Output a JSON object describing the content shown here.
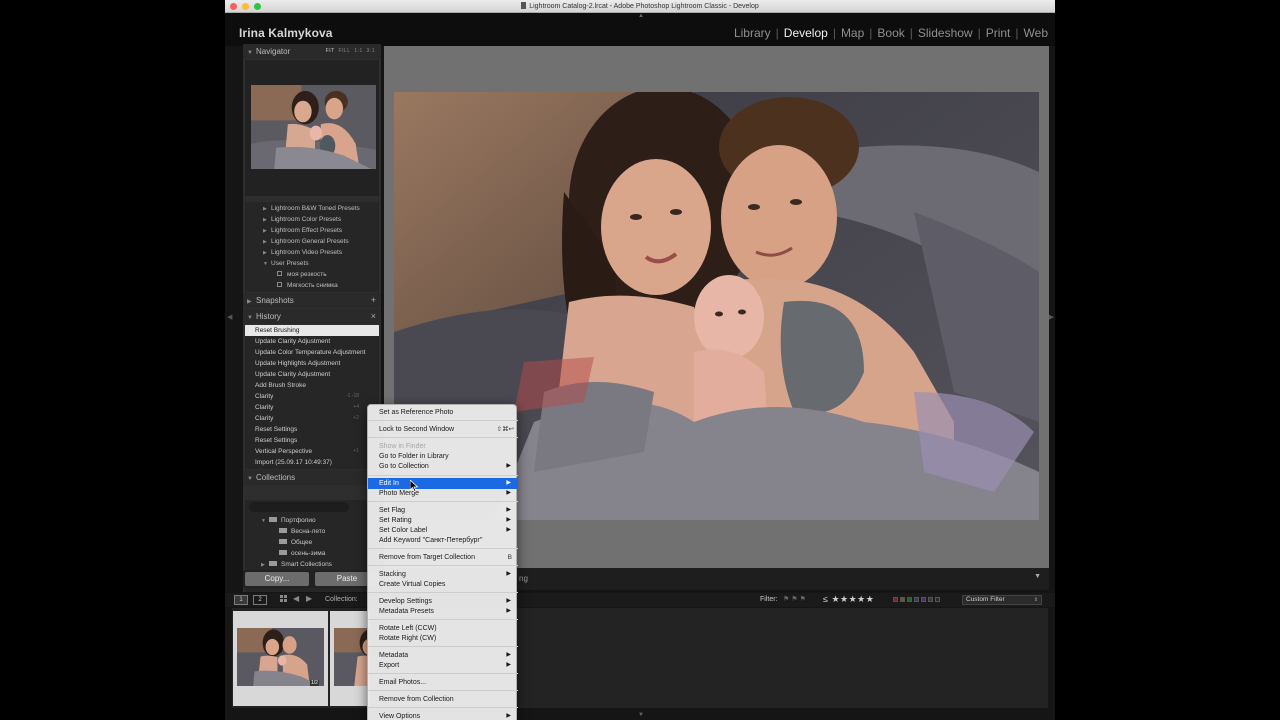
{
  "window": {
    "title": "Lightroom Catalog-2.lrcat - Adobe Photoshop Lightroom Classic - Develop"
  },
  "identity_plate": "Irina Kalmykova",
  "modules": [
    "Library",
    "Develop",
    "Map",
    "Book",
    "Slideshow",
    "Print",
    "Web"
  ],
  "navigator": {
    "title": "Navigator",
    "zoom_fit": "FIT",
    "zoom_fill": "FILL",
    "zoom_1": "1:1",
    "zoom_3": "3:1"
  },
  "presets": [
    "Lightroom B&W Toned Presets",
    "Lightroom Color Presets",
    "Lightroom Effect Presets",
    "Lightroom General Presets",
    "Lightroom Video Presets",
    "User Presets",
    "моя резкость",
    "Мягкость снимка"
  ],
  "snapshots": {
    "title": "Snapshots",
    "add": "+"
  },
  "history": {
    "title": "History",
    "close": "×",
    "items": [
      {
        "label": "Reset Brushing",
        "value": ""
      },
      {
        "label": "Update Clarity Adjustment",
        "value": ""
      },
      {
        "label": "Update Color Temperature Adjustment",
        "value": ""
      },
      {
        "label": "Update Highlights Adjustment",
        "value": ""
      },
      {
        "label": "Update Clarity Adjustment",
        "value": ""
      },
      {
        "label": "Add Brush Stroke",
        "value": ""
      },
      {
        "label": "Clarity",
        "value": "-1   -18"
      },
      {
        "label": "Clarity",
        "value": "+4"
      },
      {
        "label": "Clarity",
        "value": "+2"
      },
      {
        "label": "Reset Settings",
        "value": ""
      },
      {
        "label": "Reset Settings",
        "value": ""
      },
      {
        "label": "Vertical Perspective",
        "value": "+1"
      },
      {
        "label": "Import (25.09.17 10:49:37)",
        "value": ""
      }
    ]
  },
  "collections": {
    "title": "Collections",
    "add": "+",
    "items": [
      {
        "label": "Портфолио"
      },
      {
        "label": "Весна-лето"
      },
      {
        "label": "Общее"
      },
      {
        "label": "осень-зима"
      },
      {
        "label": "Smart Collections"
      },
      {
        "label": "1 +"
      }
    ]
  },
  "buttons": {
    "copy": "Copy...",
    "paste": "Paste"
  },
  "toolbar": {
    "text": "ng"
  },
  "filmstrip": {
    "view1": "1",
    "view2": "2",
    "source": "Collection: ",
    "filter_label": "Filter:",
    "stars_prefix": "≤",
    "stars": "★★★★★",
    "custom_filter": "Custom Filter",
    "badge": "1/2"
  },
  "context_menu": {
    "items": [
      {
        "label": "Set as Reference Photo",
        "disabled": false
      },
      {
        "label": "Lock to Second Window",
        "shortcut": "⇧⌘↩"
      },
      {
        "label": "Show in Finder",
        "disabled": true
      },
      {
        "label": "Go to Folder in Library"
      },
      {
        "label": "Go to Collection",
        "submenu": true
      },
      {
        "label": "Edit In",
        "submenu": true,
        "highlighted": true
      },
      {
        "label": "Photo Merge",
        "submenu": true
      },
      {
        "label": "Set Flag",
        "submenu": true
      },
      {
        "label": "Set Rating",
        "submenu": true
      },
      {
        "label": "Set Color Label",
        "submenu": true
      },
      {
        "label": "Add Keyword \"Санкт-Петербург\""
      },
      {
        "label": "Remove from Target Collection",
        "shortcut": "B"
      },
      {
        "label": "Stacking",
        "submenu": true
      },
      {
        "label": "Create Virtual Copies"
      },
      {
        "label": "Develop Settings",
        "submenu": true
      },
      {
        "label": "Metadata Presets",
        "submenu": true
      },
      {
        "label": "Rotate Left (CCW)"
      },
      {
        "label": "Rotate Right (CW)"
      },
      {
        "label": "Metadata",
        "submenu": true
      },
      {
        "label": "Export",
        "submenu": true
      },
      {
        "label": "Email Photos..."
      },
      {
        "label": "Remove from Collection"
      },
      {
        "label": "View Options",
        "submenu": true
      }
    ]
  },
  "colors": {
    "menu_highlight": "#1b6ae4",
    "active_module": "#f0f0f0",
    "panel_bg": "#2e2e2e"
  }
}
